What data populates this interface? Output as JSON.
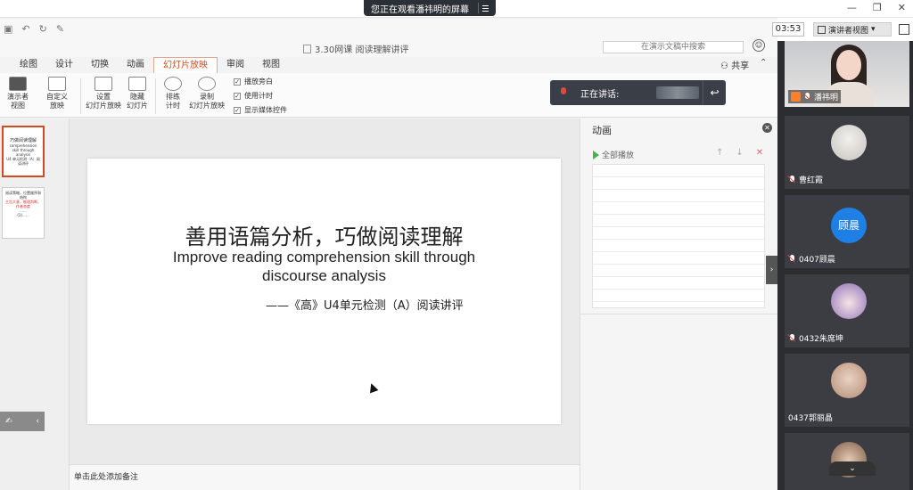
{
  "meeting": {
    "share_status": "您正在观看潘祎明的屏幕",
    "timer": "03:53",
    "presenter_view": "演讲者视图",
    "speaking_label": "正在讲话:",
    "participants": [
      {
        "name": "潘祎明",
        "type": "camera",
        "host": true
      },
      {
        "name": "曹红霞",
        "type": "avatar-cat"
      },
      {
        "name": "0407顾晨",
        "type": "text",
        "avatar_text": "顾晨"
      },
      {
        "name": "0432朱席坤",
        "type": "avatar-anime"
      },
      {
        "name": "0437郭丽晶",
        "type": "avatar-bear"
      }
    ]
  },
  "app": {
    "doc_title": "3.30网课 阅读理解讲评",
    "search_placeholder": "在演示文稿中搜索",
    "share_label": "共享",
    "tabs": [
      "绘图",
      "设计",
      "切换",
      "动画",
      "幻灯片放映",
      "审阅",
      "视图"
    ],
    "active_tab": "幻灯片放映",
    "ribbon": {
      "presenter_view": "演示者\n视图",
      "custom_show": "自定义\n放映",
      "setup_show": "设置\n幻灯片放映",
      "hide_slide": "隐藏\n幻灯片",
      "rehearse": "排练\n计时",
      "record": "录制\n幻灯片放映",
      "checks": [
        "播放旁白",
        "使用计时",
        "显示媒体控件"
      ]
    },
    "notes_placeholder": "单击此处添加备注",
    "animation_pane": {
      "title": "动画",
      "play_all": "全部播放"
    }
  },
  "slide": {
    "title_cn": "善用语篇分析，巧做阅读理解",
    "title_en": "Improve reading comprehension skill through discourse analysis",
    "subtitle": "——《高》U4单元检测（A）阅读讲评"
  },
  "thumbnails": [
    {
      "lines": [
        "巧做阅读理解",
        "comprehension skill through",
        "analysis",
        "U4 单元检测（A）阅读讲评"
      ]
    },
    {
      "lines": [
        "阅读策略，位置顺序和结构",
        "主旨大意，推理判断，作者态度",
        "......",
        "(1)......"
      ]
    }
  ]
}
